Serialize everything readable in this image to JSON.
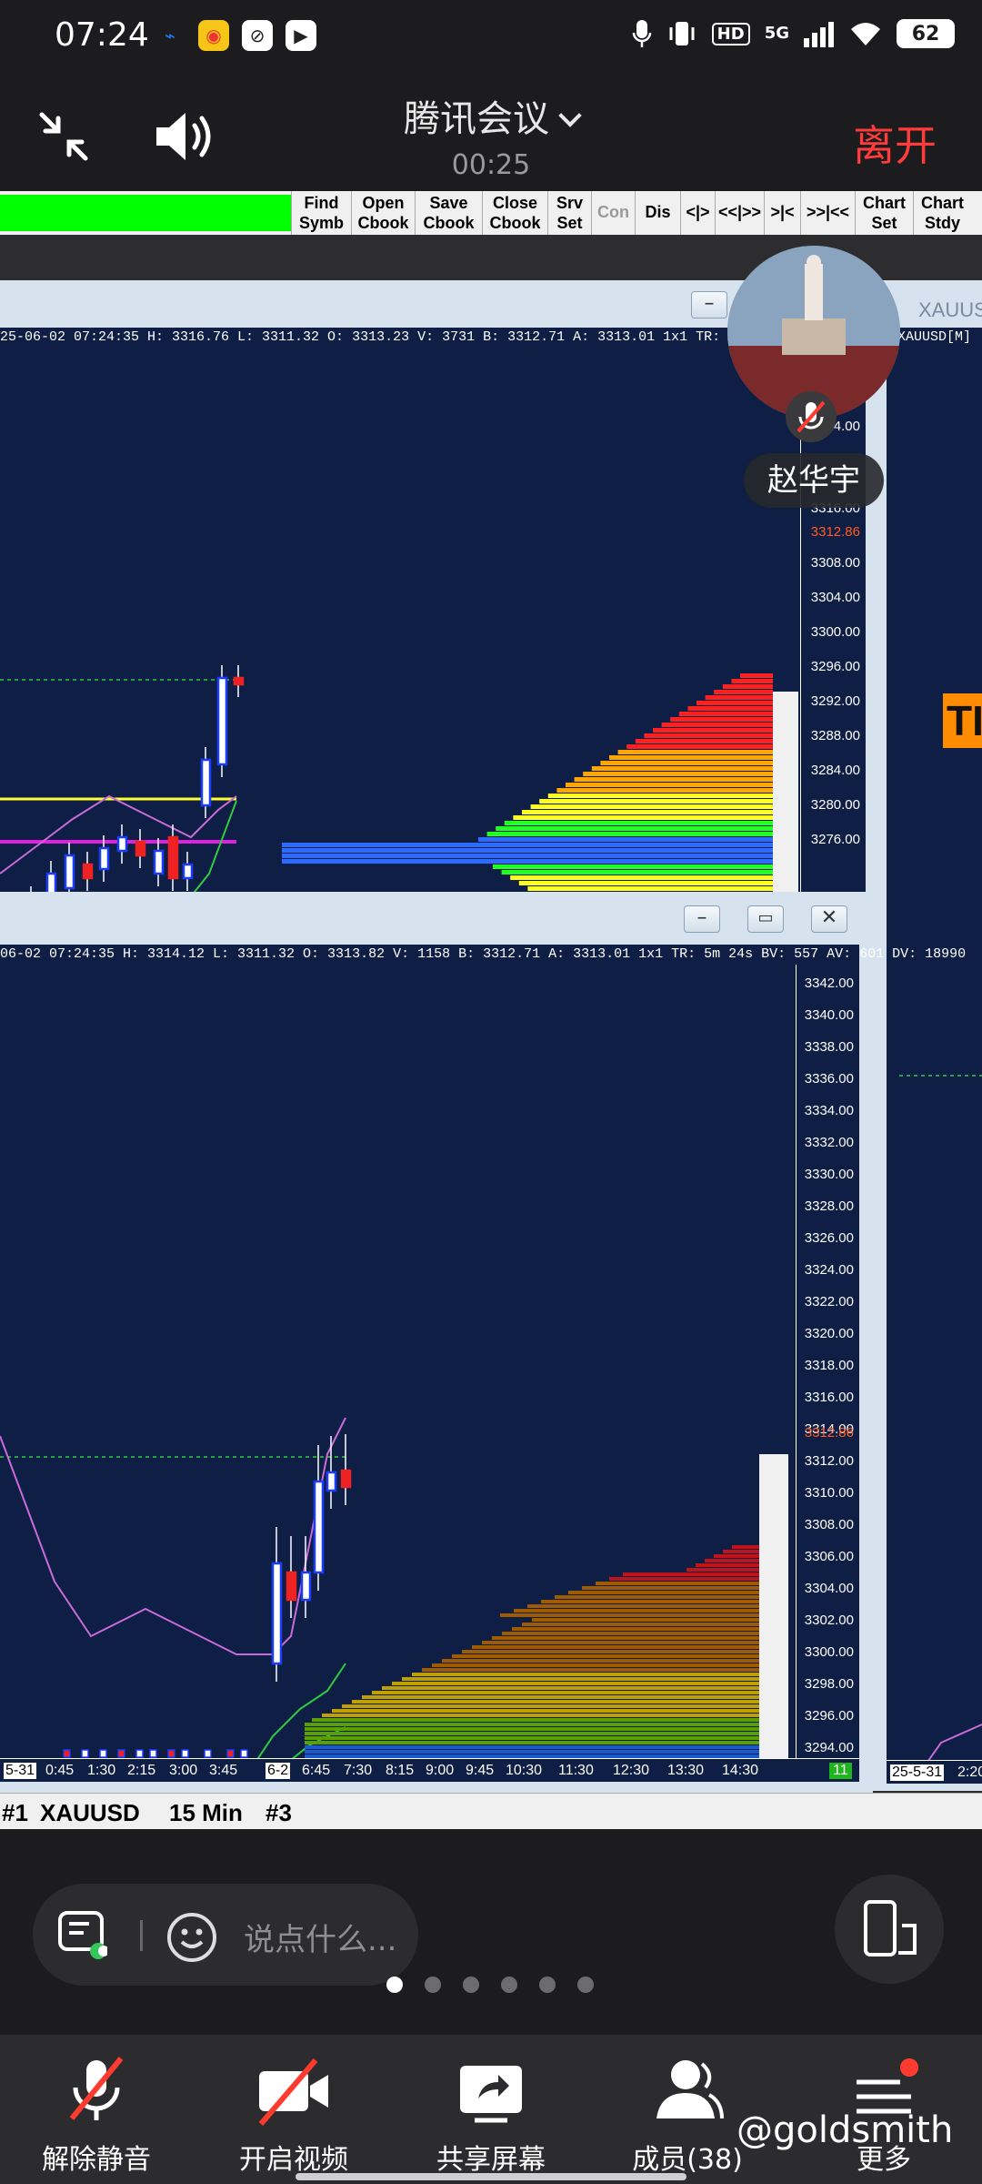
{
  "status_bar": {
    "time": "07:24",
    "network": "5G",
    "battery": "62"
  },
  "meeting": {
    "title": "腾讯会议",
    "elapsed": "00:25",
    "leave_label": "离开"
  },
  "shared_screen": {
    "toolbar": [
      {
        "line1": "Find",
        "line2": "Symb"
      },
      {
        "line1": "Open",
        "line2": "Cbook"
      },
      {
        "line1": "Save",
        "line2": "Cbook"
      },
      {
        "line1": "Close",
        "line2": "Cbook"
      },
      {
        "line1": "Srv",
        "line2": "Set"
      },
      {
        "line1": "Con",
        "line2": ""
      },
      {
        "line1": "Dis",
        "line2": ""
      },
      {
        "line1": "<|>",
        "line2": ""
      },
      {
        "line1": "<<|>>",
        "line2": ""
      },
      {
        "line1": ">|<",
        "line2": ""
      },
      {
        "line1": ">>|<<",
        "line2": ""
      },
      {
        "line1": "Chart",
        "line2": "Set"
      },
      {
        "line1": "Chart",
        "line2": "Stdy"
      }
    ],
    "top_chart": {
      "info": "25-06-02 07:24:35 H: 3316.76 L: 3311.32 O: 3313.23 V: 3731 B: 3312.71 A: 3313.01 1x1 TR: 5m 24s BV: 1806 AV: 1",
      "price_ticks": [
        "3324.00",
        "3316.00",
        "3312.86",
        "3308.00",
        "3304.00",
        "3300.00",
        "3296.00",
        "3292.00",
        "3288.00",
        "3284.00",
        "3280.00",
        "3276.00"
      ],
      "current_price": "3312.86"
    },
    "right_chart": {
      "title": "XAUUS",
      "subtitle": "XAUUSD[M]",
      "badge": "TI",
      "time_ticks": [
        "25-5-31",
        "2:20"
      ]
    },
    "bottom_chart": {
      "info": "06-02 07:24:35 H: 3314.12 L: 3311.32 O: 3313.82 V: 1158 B: 3312.71 A: 3313.01 1x1 TR: 5m 24s BV: 557 AV: 601 DV: 18990",
      "price_ticks": [
        "3342.00",
        "3340.00",
        "3338.00",
        "3336.00",
        "3334.00",
        "3332.00",
        "3330.00",
        "3328.00",
        "3326.00",
        "3324.00",
        "3322.00",
        "3320.00",
        "3318.00",
        "3316.00",
        "3314.00",
        "3312.86",
        "3312.00",
        "3310.00",
        "3308.00",
        "3306.00",
        "3304.00",
        "3302.00",
        "3300.00",
        "3298.00",
        "3296.00",
        "3294.00"
      ],
      "current_price": "3312.86",
      "time_ticks": [
        "5-31",
        "0:45",
        "1:30",
        "2:15",
        "3:00",
        "3:45",
        "6-2",
        "6:45",
        "7:30",
        "8:15",
        "9:00",
        "9:45",
        "10:30",
        "11:30",
        "12:30",
        "13:30",
        "14:30"
      ],
      "corner": "11"
    },
    "tabs": [
      "#1",
      "XAUUSD",
      "15 Min",
      "#3"
    ]
  },
  "participant": {
    "name": "赵华宇"
  },
  "chat": {
    "placeholder": "说点什么..."
  },
  "controls": {
    "unmute": "解除静音",
    "video": "开启视频",
    "share": "共享屏幕",
    "members": "成员(38)",
    "more": "更多"
  },
  "watermark": "@goldsmith",
  "colors": {
    "leave": "#ff3b3b",
    "chart_bg": "#0f1e45",
    "toolbar_green": "#00ff00",
    "current_price": "#ff5a1f"
  }
}
